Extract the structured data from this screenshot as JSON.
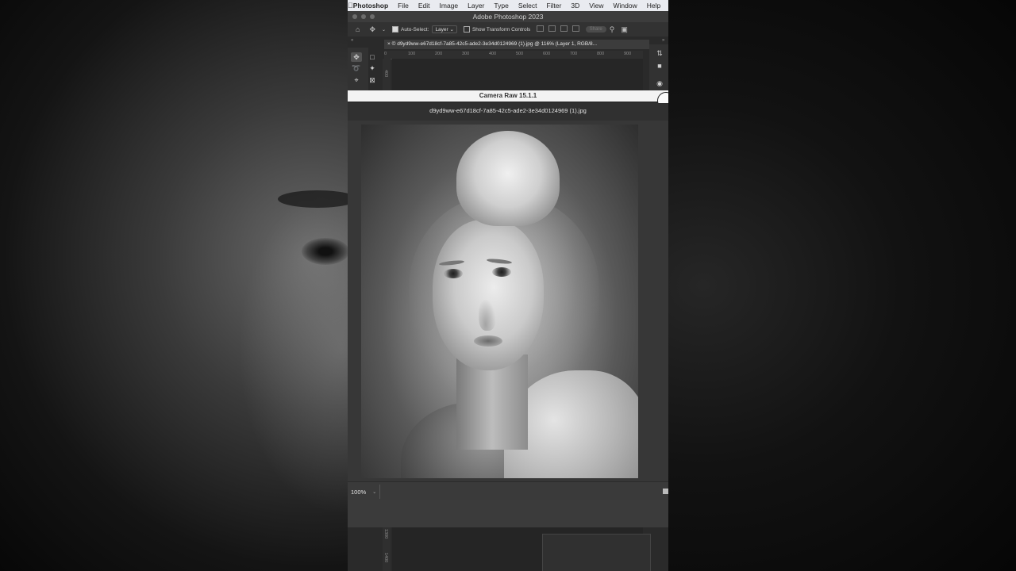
{
  "menubar": {
    "app": "Photoshop",
    "items": [
      "File",
      "Edit",
      "Image",
      "Layer",
      "Type",
      "Select",
      "Filter",
      "3D",
      "View",
      "Window",
      "Help"
    ]
  },
  "window": {
    "title": "Adobe Photoshop 2023"
  },
  "options_bar": {
    "auto_select_label": "Auto-Select:",
    "auto_select_value": "Layer",
    "transform_label": "Show Transform Controls",
    "share_label": "Share"
  },
  "document": {
    "tab_title": "© d9yd9ww-e67d18cf-7a85-42c5-ade2-3e34d0124969 (1).jpg @ 116% (Layer 1, RGB/8...",
    "ruler_h": [
      "0",
      "100",
      "200",
      "300",
      "400",
      "500",
      "600",
      "700",
      "800",
      "900"
    ],
    "ruler_v": [
      "400"
    ],
    "ruler_v_bottom": [
      "1300",
      "1400"
    ]
  },
  "camera_raw": {
    "title": "Camera Raw 15.1.1",
    "filename": "d9yd9ww-e67d18cf-7a85-42c5-ade2-3e34d0124969 (1).jpg",
    "zoom": "100%"
  },
  "colors": {
    "menubar_bg": "#e9ebf0",
    "ps_dark": "#2b2b2b",
    "camera_raw_header": "#f3f3f3"
  }
}
